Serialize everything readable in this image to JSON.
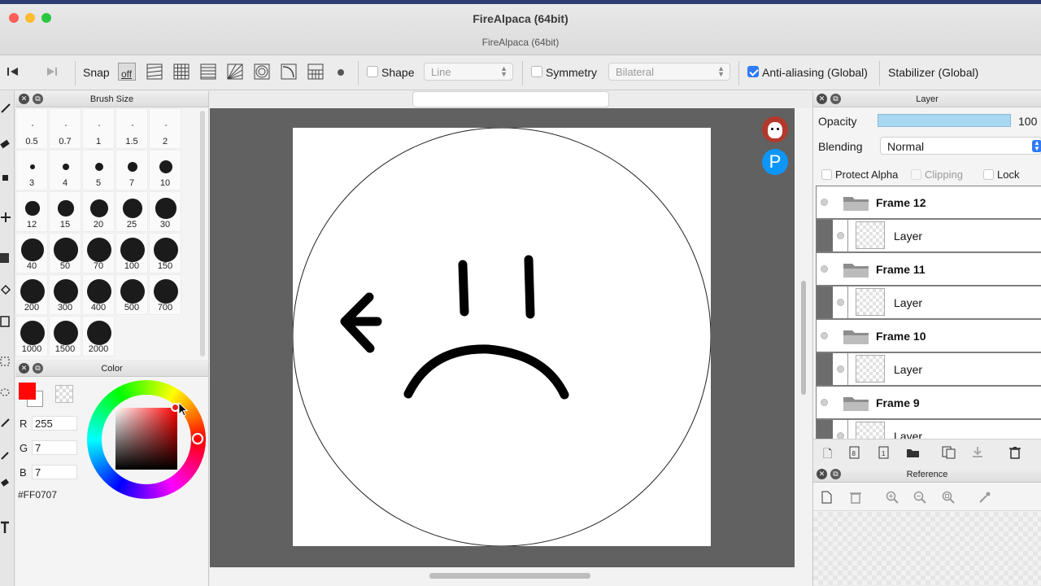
{
  "window": {
    "title": "FireAlpaca (64bit)",
    "document_title": "FireAlpaca (64bit)"
  },
  "toolbar": {
    "snap_label": "Snap",
    "snap_off_label": "off",
    "shape_label": "Shape",
    "shape_value": "Line",
    "symmetry_label": "Symmetry",
    "symmetry_value": "Bilateral",
    "antialias_label": "Anti-aliasing (Global)",
    "stabilizer_label": "Stabilizer (Global)",
    "shape_checked": false,
    "symmetry_checked": false,
    "antialias_checked": true
  },
  "brush_panel": {
    "title": "Brush Size",
    "sizes": [
      "0.5",
      "0.7",
      "1",
      "1.5",
      "2",
      "3",
      "4",
      "5",
      "7",
      "10",
      "12",
      "15",
      "20",
      "25",
      "30",
      "40",
      "50",
      "70",
      "100",
      "150",
      "200",
      "300",
      "400",
      "500",
      "700",
      "1000",
      "1500",
      "2000"
    ]
  },
  "color_panel": {
    "title": "Color",
    "r_label": "R",
    "r": "255",
    "g_label": "G",
    "g": "7",
    "b_label": "B",
    "b": "7",
    "hex": "#FF0707",
    "primary_color": "#FF0707",
    "secondary_color": "#FFFFFF"
  },
  "layer_panel": {
    "title": "Layer",
    "opacity_label": "Opacity",
    "opacity_value": "100",
    "blending_label": "Blending",
    "blending_value": "Normal",
    "protect_alpha_label": "Protect Alpha",
    "clipping_label": "Clipping",
    "lock_label": "Lock",
    "layers": [
      {
        "name": "Frame 12",
        "type": "folder"
      },
      {
        "name": "Layer",
        "type": "layer"
      },
      {
        "name": "Frame 11",
        "type": "folder"
      },
      {
        "name": "Layer",
        "type": "layer"
      },
      {
        "name": "Frame 10",
        "type": "folder"
      },
      {
        "name": "Layer",
        "type": "layer"
      },
      {
        "name": "Frame 9",
        "type": "folder"
      },
      {
        "name": "Layer",
        "type": "layer"
      }
    ]
  },
  "reference_panel": {
    "title": "Reference"
  },
  "canvas": {
    "drawing": "sad face with arrow",
    "avatar_icon": "alpaca-icon",
    "pixiv_icon": "pixiv-icon",
    "pixiv_letter": "P"
  },
  "colors": {
    "accent": "#2f7bf5",
    "opacity_bar": "#a9d8f3",
    "canvas_bg": "#616161"
  }
}
